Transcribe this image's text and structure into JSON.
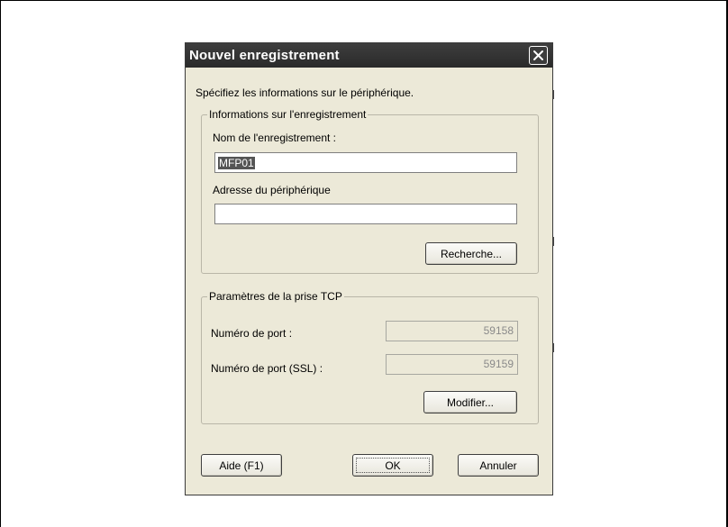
{
  "dialog": {
    "title": "Nouvel enregistrement",
    "prompt": "Spécifiez les informations sur le périphérique."
  },
  "registration_group": {
    "legend": "Informations sur l'enregistrement",
    "name_label": "Nom de l'enregistrement :",
    "name_value": "MFP01",
    "address_label": "Adresse du périphérique",
    "address_value": "",
    "search_button": "Recherche..."
  },
  "tcp_group": {
    "legend": "Paramètres de la prise TCP",
    "port_label": "Numéro de port :",
    "port_value": "59158",
    "ssl_port_label": "Numéro de port (SSL) :",
    "ssl_port_value": "59159",
    "modify_button": "Modifier..."
  },
  "footer": {
    "help_button": "Aide (F1)",
    "ok_button": "OK",
    "cancel_button": "Annuler"
  },
  "icons": {
    "close": "close-icon"
  }
}
